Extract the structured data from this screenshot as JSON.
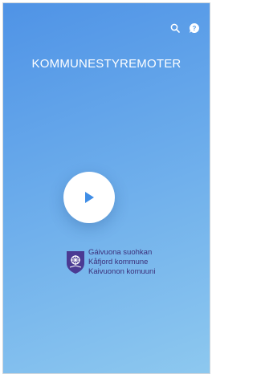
{
  "app": {
    "title": "KOMMUNESTYREMOTER"
  },
  "toolbar": {
    "search_icon": "search-icon",
    "help_icon": "help-icon"
  },
  "player": {
    "play_icon": "play-icon"
  },
  "logo": {
    "lines": [
      "Gáivuona suohkan",
      "Kåfjord kommune",
      "Kaivuonon komuuni"
    ],
    "crest": "municipality-crest-icon"
  },
  "colors": {
    "gradient_top": "#4f93e6",
    "gradient_bottom": "#8dc8ef",
    "play_accent": "#3f8de6",
    "logo_color": "#3b2f7a"
  }
}
